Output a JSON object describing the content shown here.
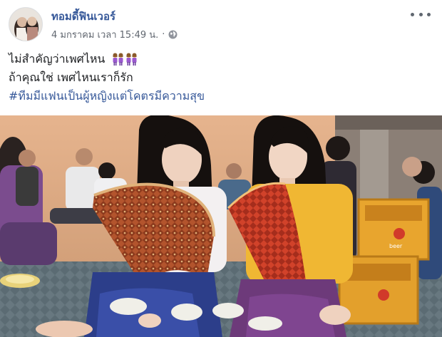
{
  "post": {
    "author": "ทอมดี้ฟินเวอร์",
    "timestamp": "4 มกราคม เวลา 15:49 น.",
    "separator": "·",
    "privacy_icon": "globe-icon",
    "more_icon": "more-options-icon",
    "lines": [
      "ไม่สำคัญว่าเพศไหน",
      "ถ้าคุณใช่ เพศไหนเราก็รัก"
    ],
    "hashtag": "#ทีมมีแฟนเป็นผู้หญิงแต่โคตรมีความสุข",
    "emoji": "couple-women-icon",
    "crate_label": "beer"
  },
  "colors": {
    "author_link": "#365899",
    "meta_text": "#616770",
    "hashtag": "#365899",
    "body_text": "#1c1e21"
  }
}
